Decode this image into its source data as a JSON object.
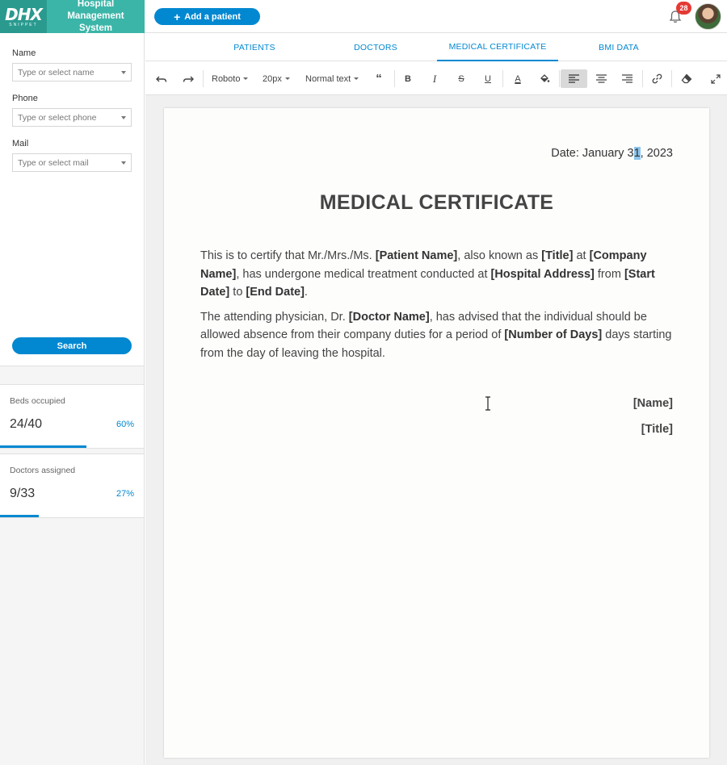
{
  "app": {
    "logo_text": "DHX",
    "logo_sub": "SNIPPET",
    "title": "Hospital Management System",
    "add_button": "Add a patient",
    "notifications_count": "28"
  },
  "filters": {
    "name_label": "Name",
    "name_placeholder": "Type or select name",
    "phone_label": "Phone",
    "phone_placeholder": "Type or select phone",
    "mail_label": "Mail",
    "mail_placeholder": "Type or select mail",
    "search_button": "Search"
  },
  "stats": [
    {
      "label": "Beds occupied",
      "value": "24/40",
      "percent_text": "60%",
      "percent": 60
    },
    {
      "label": "Doctors assigned",
      "value": "9/33",
      "percent_text": "27%",
      "percent": 27
    }
  ],
  "tabs": [
    {
      "label": "PATIENTS",
      "active": false
    },
    {
      "label": "DOCTORS",
      "active": false
    },
    {
      "label": "MEDICAL CERTIFICATE",
      "active": true
    },
    {
      "label": "BMI DATA",
      "active": false
    }
  ],
  "toolbar": {
    "font_family": "Roboto",
    "font_size": "20px",
    "block_type": "Normal text",
    "quote": "“",
    "bold": "B",
    "italic": "I",
    "strike": "S",
    "underline": "U",
    "text_color": "A",
    "active_align": "left"
  },
  "document": {
    "date_prefix": "Date: January 3",
    "date_selected": "1",
    "date_suffix": ", 2023",
    "title": "MEDICAL CERTIFICATE",
    "p1": {
      "t1": "This is to certify that Mr./Mrs./Ms. ",
      "b1": "[Patient Name]",
      "t2": ", also known as ",
      "b2": "[Title]",
      "t3": " at ",
      "b3": "[Company Name]",
      "t4": ", has undergone medical treatment conducted at ",
      "b4": "[Hospital Address]",
      "t5": " from ",
      "b5": "[Start Date]",
      "t6": " to ",
      "b6": "[End Date]",
      "t7": "."
    },
    "p2": {
      "t1": "The attending physician, Dr. ",
      "b1": "[Doctor Name]",
      "t2": ", has advised that the individual should be allowed absence from their company duties for a period of ",
      "b2": "[Number of Days]",
      "t3": " days starting from the day of leaving the hospital."
    },
    "signature_name": "[Name]",
    "signature_title": "[Title]"
  },
  "colors": {
    "brand": "#3bb5a8",
    "accent": "#0288d1",
    "badge": "#e53935"
  }
}
